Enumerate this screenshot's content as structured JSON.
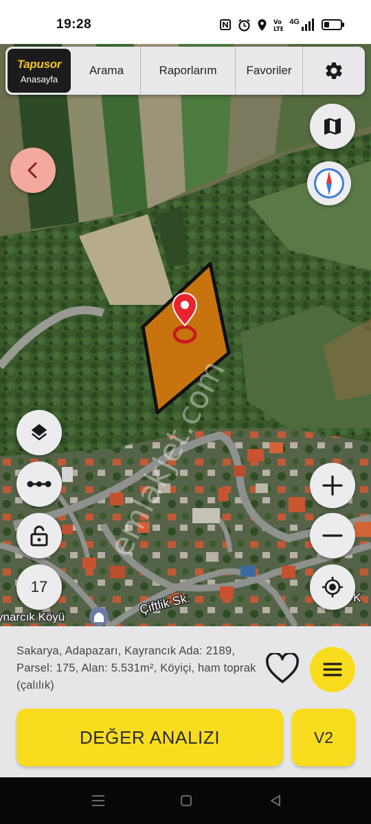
{
  "status_bar": {
    "time": "19:28",
    "icons": [
      "nfc-icon",
      "alarm-icon",
      "location-icon",
      "volte-icon",
      "signal-icon",
      "battery-icon"
    ],
    "network_label": "4G"
  },
  "nav": {
    "brand_logo": "Tapusor",
    "brand_home": "Anasayfa",
    "tabs": [
      "Arama",
      "Raporlarım",
      "Favoriler"
    ],
    "settings_icon": "gear-icon"
  },
  "map": {
    "street_label": "Çiftlik Sk.",
    "village_label": "ynarcık Köyü",
    "village_label_right": "rcık K",
    "watermark": "emlakjet.com",
    "parcel_color": "#c8740e",
    "marker_color": "#e8242c",
    "zoom_level": "17",
    "buttons": {
      "back": "chevron-left-icon",
      "basemap": "map-icon",
      "compass": "compass-icon",
      "layers": "layers-icon",
      "measure": "measure-icon",
      "lock": "lock-icon",
      "zoom_in": "plus-icon",
      "zoom_out": "minus-icon",
      "locate": "locate-icon"
    }
  },
  "panel": {
    "parcel_info": "Sakarya, Adapazarı, Kayrancık Ada: 2189, Parsel: 175, Alan: 5.531m², Köyiçi, ham toprak (çalılık)",
    "favorite_icon": "heart-icon",
    "menu_icon": "menu-icon",
    "analyze_label": "DEĞER ANALIZI",
    "v2_label": "V2",
    "accent_color": "#f9dc1d"
  },
  "system_nav": [
    "recents-icon",
    "home-icon",
    "back-icon"
  ]
}
